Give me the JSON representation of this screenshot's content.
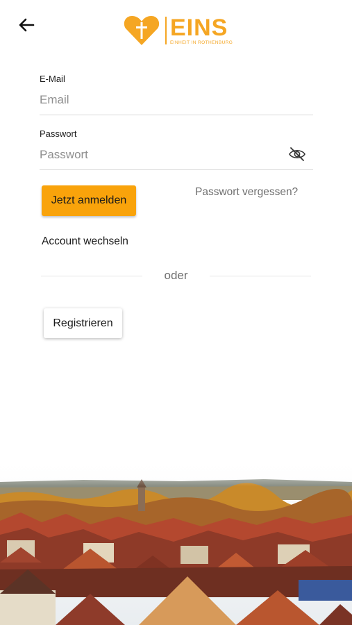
{
  "header": {
    "back_icon": "arrow-left-icon",
    "logo": {
      "title": "EINS",
      "subtitle": "EINHEIT IN ROTHENBURG",
      "icon": "heart-cross-icon",
      "color": "#f5a623"
    }
  },
  "form": {
    "email": {
      "label": "E-Mail",
      "placeholder": "Email",
      "value": ""
    },
    "password": {
      "label": "Passwort",
      "placeholder": "Passwort",
      "value": "",
      "toggle_icon": "eye-off-icon"
    }
  },
  "actions": {
    "login_label": "Jetzt anmelden",
    "forgot_label": "Passwort vergessen?",
    "switch_account_label": "Account wechseln",
    "divider_label": "oder",
    "register_label": "Registrieren"
  },
  "colors": {
    "accent": "#f9a30b",
    "text": "#1a1a1a",
    "muted": "#6f6f6f"
  },
  "footer_image": "rothenburg-town-rooftops-photo"
}
